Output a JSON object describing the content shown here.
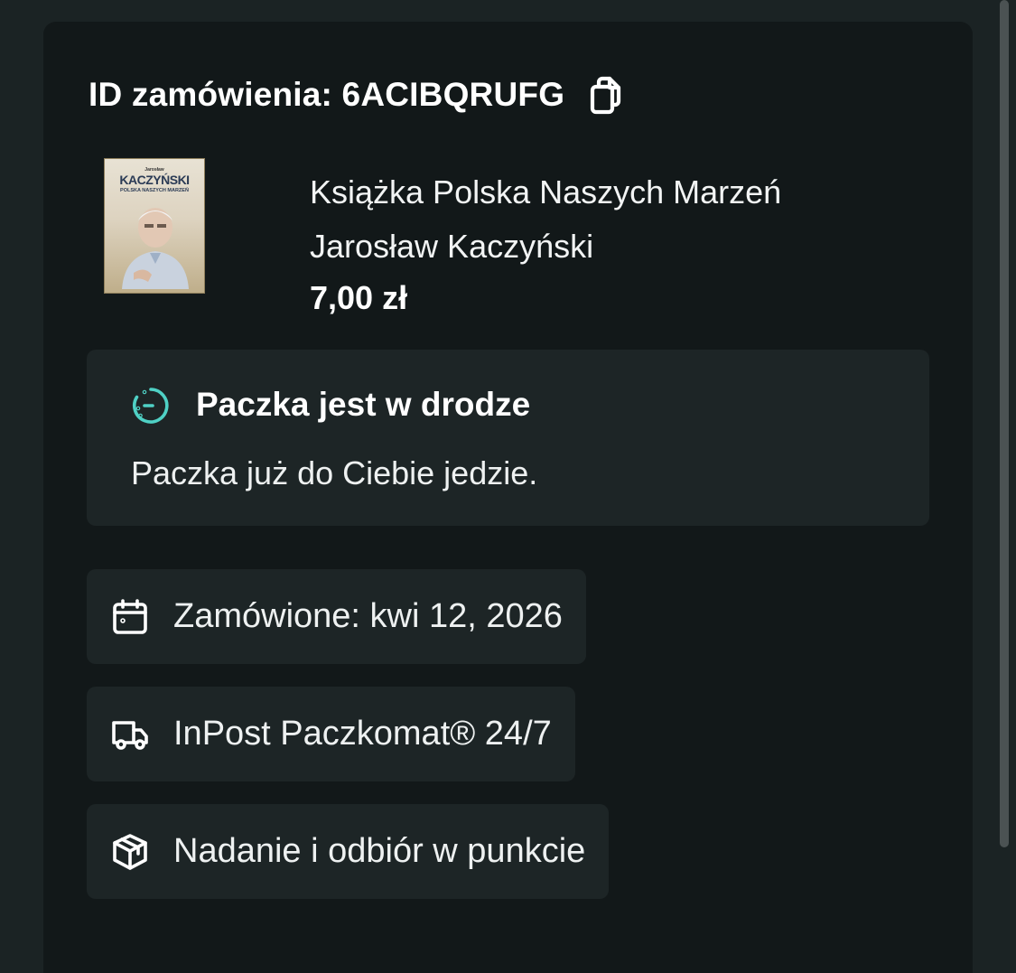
{
  "order": {
    "id_text": "ID zamówienia: 6ACIBQRUFG",
    "copy_icon": "copy-icon"
  },
  "product": {
    "cover_author": "Jarosław",
    "cover_title": "KACZYŃSKI",
    "cover_subtitle": "POLSKA NASZYCH MARZEŃ",
    "title": "Książka Polska Naszych Marzeń",
    "author": "Jarosław Kaczyński",
    "price": "7,00 zł"
  },
  "status": {
    "icon": "timer-icon",
    "title": "Paczka jest w drodze",
    "description": "Paczka już do Ciebie jedzie.",
    "accent_color": "#4fd1c5"
  },
  "details": [
    {
      "icon": "calendar-icon",
      "label": "Zamówione: kwi 12, 2026"
    },
    {
      "icon": "truck-icon",
      "label": "InPost Paczkomat® 24/7"
    },
    {
      "icon": "package-icon",
      "label": "Nadanie i odbiór w punkcie"
    }
  ],
  "colors": {
    "background": "#1b2324",
    "card": "#121819",
    "panel": "#1d2526",
    "text": "#ffffff"
  }
}
